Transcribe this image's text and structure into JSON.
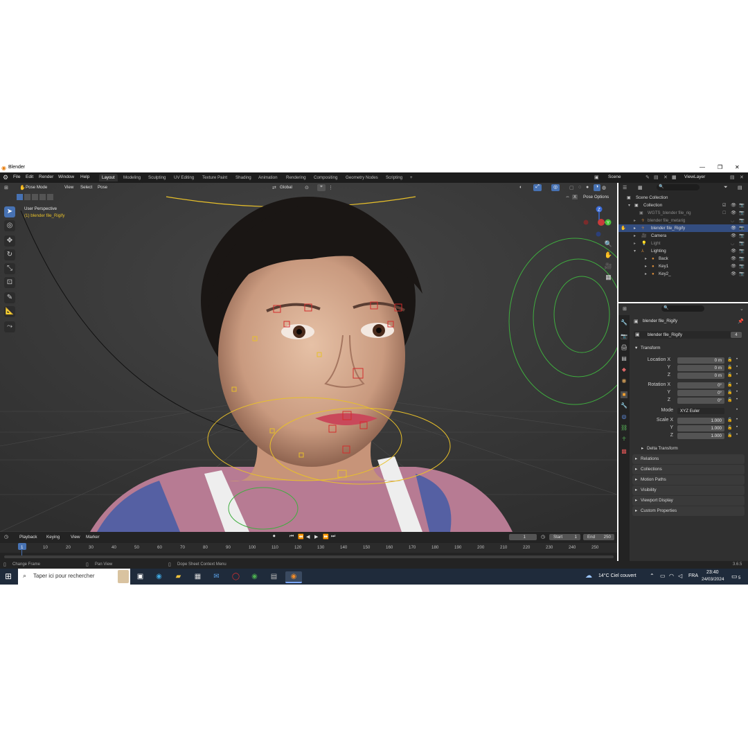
{
  "window": {
    "title": "Blender",
    "minimize": "—",
    "maximize": "❐",
    "close": "✕"
  },
  "menu": {
    "items": [
      "File",
      "Edit",
      "Render",
      "Window",
      "Help"
    ]
  },
  "workspaces": [
    "Layout",
    "Modeling",
    "Sculpting",
    "UV Editing",
    "Texture Paint",
    "Shading",
    "Animation",
    "Rendering",
    "Compositing",
    "Geometry Nodes",
    "Scripting",
    "+"
  ],
  "scene": {
    "name": "Scene",
    "view_layer": "ViewLayer"
  },
  "viewport": {
    "mode": "Pose Mode",
    "menus": [
      "View",
      "Select",
      "Pose"
    ],
    "orientation": "Global",
    "pose_options": "Pose Options",
    "x_label": "X",
    "perspective_label": "User Perspective",
    "active_object_label": "(1) blender file_Rigify",
    "axis_y": "Y",
    "axis_z": "Z"
  },
  "outliner": {
    "rows": [
      {
        "label": "Scene Collection"
      },
      {
        "label": "Collection"
      },
      {
        "label": "WGTS_blender file_rig"
      },
      {
        "label": "blender file_metarig"
      },
      {
        "label": "blender file_Rigify"
      },
      {
        "label": "Camera"
      },
      {
        "label": "Light"
      },
      {
        "label": "Lighting"
      },
      {
        "label": "Back"
      },
      {
        "label": "Key1"
      },
      {
        "label": "Key2_"
      }
    ]
  },
  "properties": {
    "object_name": "blender file_Rigify",
    "data_name": "blender file_Rigify",
    "users": "4",
    "transform": {
      "title": "Transform",
      "location_label": "Location X",
      "location": [
        "0 m",
        "0 m",
        "0 m"
      ],
      "rotation_label": "Rotation X",
      "rotation": [
        "0°",
        "0°",
        "0°"
      ],
      "mode_label": "Mode",
      "mode": "XYZ Euler",
      "scale_label": "Scale X",
      "scale": [
        "1.000",
        "1.000",
        "1.000"
      ],
      "y_label": "Y",
      "z_label": "Z"
    },
    "panels": [
      "Delta Transform",
      "Relations",
      "Collections",
      "Motion Paths",
      "Visibility",
      "Viewport Display",
      "Custom Properties"
    ]
  },
  "timeline": {
    "menus": [
      "Playback",
      "Keying",
      "View",
      "Marker"
    ],
    "current_frame": "1",
    "start_label": "Start",
    "start": "1",
    "end_label": "End",
    "end": "250",
    "ticks": [
      "1",
      "10",
      "20",
      "30",
      "40",
      "50",
      "60",
      "70",
      "80",
      "90",
      "100",
      "110",
      "120",
      "130",
      "140",
      "150",
      "160",
      "170",
      "180",
      "190",
      "200",
      "210",
      "220",
      "230",
      "240",
      "250"
    ]
  },
  "statusbar": {
    "items": [
      "Change Frame",
      "Pan View",
      "Dope Sheet Context Menu"
    ],
    "version": "3.6.5"
  },
  "taskbar": {
    "search_placeholder": "Taper ici pour rechercher",
    "weather": "14°C  Ciel couvert",
    "lang": "FRA",
    "time": "23:40",
    "date": "24/03/2024",
    "notifications": "5"
  },
  "colors": {
    "accent": "#4772b3",
    "selected_row": "#334d80",
    "viewport_bg": "#3a3a3a",
    "panel_bg": "#303030",
    "taskbar": "#1f2b3b"
  }
}
